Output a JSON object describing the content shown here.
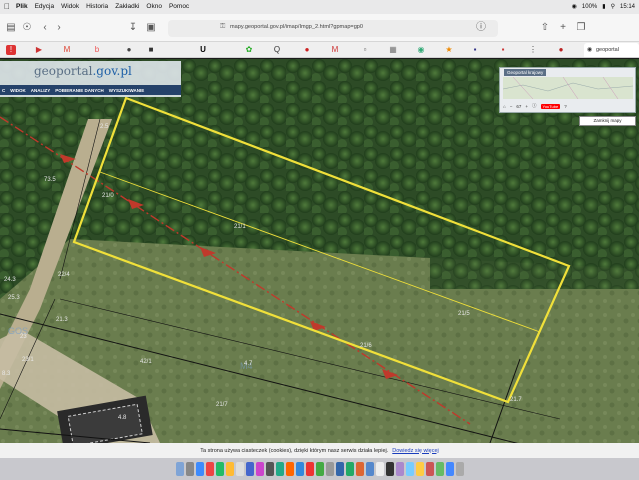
{
  "menubar": {
    "app_name": "Plik",
    "items": [
      "Edycja",
      "Widok",
      "Historia",
      "Zakładki",
      "Okno",
      "Pomoc"
    ],
    "battery": "100%",
    "clock": "15:14"
  },
  "browser": {
    "url": "mapy.geoportal.gov.pl/imap/Imgp_2.html?gpmap=gp0",
    "active_tab_title": "geoportal"
  },
  "geoportal": {
    "logo_text": "geoportal",
    "logo_domain": ".gov.pl",
    "menu": [
      "C",
      "WIDOK",
      "ANALIZY",
      "POBIERANIE DANYCH",
      "WYSZUKIWANIE"
    ],
    "overview_title": "Geoportal krajowy",
    "overview_zoom": "67",
    "youtube_label": "YouTube",
    "print_button": "Zamknij mapy"
  },
  "plot_labels": [
    "73.5",
    "21/0",
    "21/1",
    "21/5",
    "22/4",
    "24.3",
    "25.3",
    "21.3",
    "23",
    "23/1",
    "8.3",
    "4.8",
    "42/1",
    "4.7",
    "21/7",
    "2.5",
    "21/6",
    "21.7"
  ],
  "cookie": {
    "message": "Ta strona używa ciasteczek (cookies), dzięki którym nasz serwis działa lepiej.",
    "link": "Dowiedz się więcej"
  },
  "colors": {
    "parcel_outline": "#f0e03a",
    "power_line": "#c0392b",
    "accent_menu": "#25426a"
  }
}
